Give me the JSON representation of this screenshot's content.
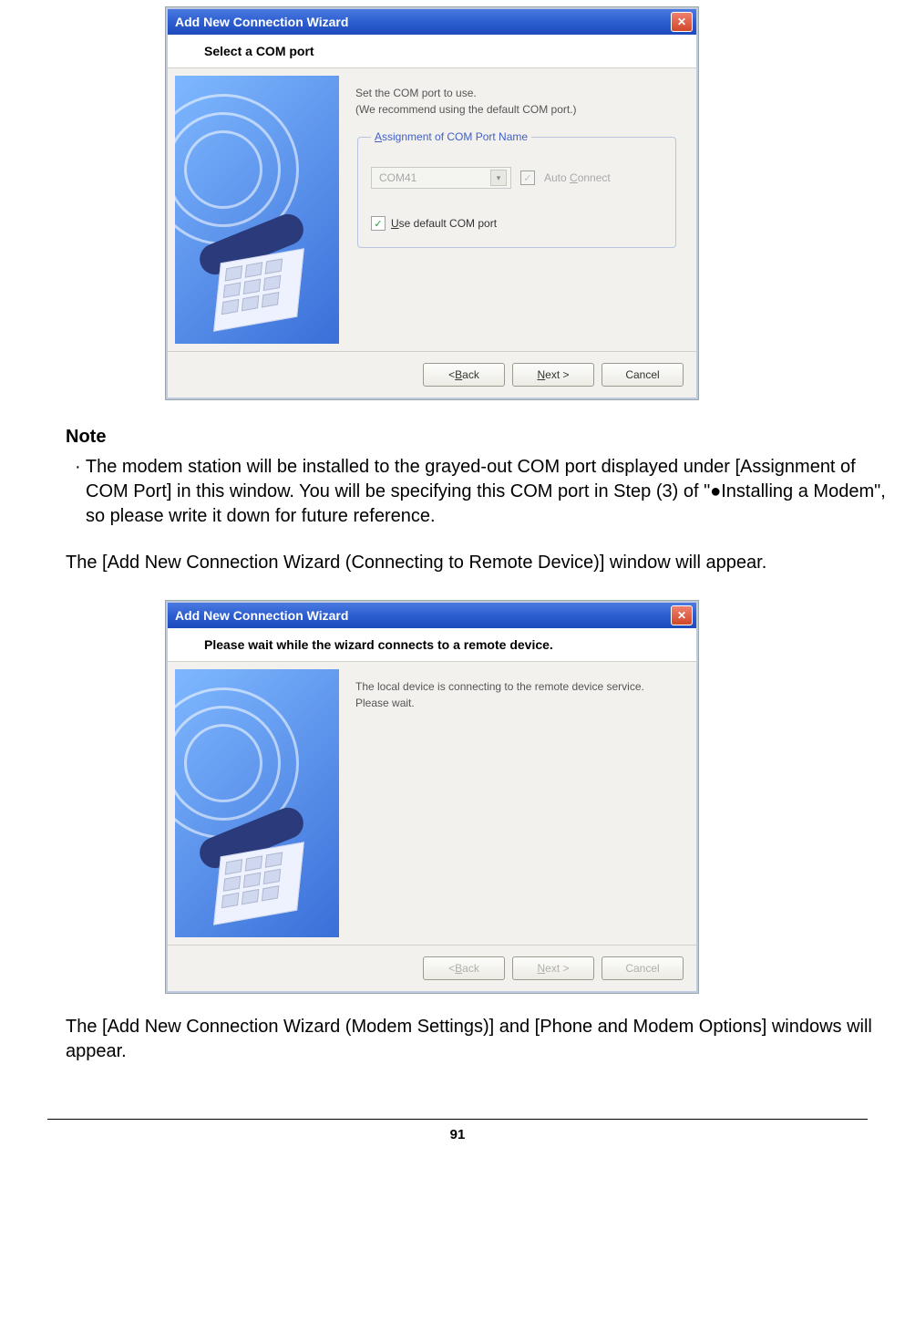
{
  "page_number": "91",
  "dialog1": {
    "title": "Add New Connection Wizard",
    "subtitle": "Select a COM port",
    "instr1": "Set the COM port to use.",
    "instr2": "(We recommend using the default COM port.)",
    "fieldset_legend": "Assignment of COM Port Name",
    "combo_value": "COM41",
    "auto_connect_label": "Auto Connect",
    "use_default_label": "Use default COM port",
    "back_btn": "< Back",
    "next_btn": "Next >",
    "cancel_btn": "Cancel"
  },
  "note_title": "Note",
  "note_body": "· The modem station will be installed to the grayed-out COM port displayed under [Assignment of COM Port] in this window. You will be specifying this COM port in Step (3) of \"●Installing a Modem\", so please write it down for future reference.",
  "body_text_1": "The [Add New Connection Wizard (Connecting to Remote Device)] window will appear.",
  "dialog2": {
    "title": "Add New Connection Wizard",
    "subtitle": "Please wait while the wizard connects to a remote device.",
    "msg1": "The local device is connecting to the remote device service.",
    "msg2": "Please wait.",
    "back_btn": "< Back",
    "next_btn": "Next >",
    "cancel_btn": "Cancel"
  },
  "body_text_2": "The [Add New Connection Wizard (Modem Settings)] and [Phone and Modem Options] windows will appear."
}
